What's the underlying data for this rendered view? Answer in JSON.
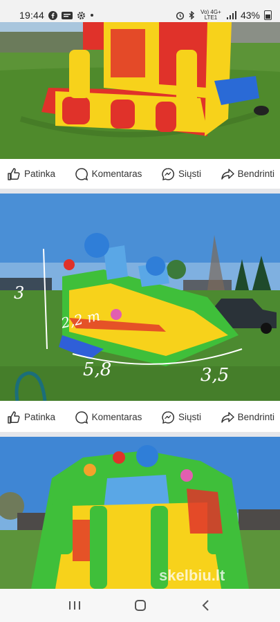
{
  "status_bar": {
    "time": "19:44",
    "network": "Vo) 4G+ LTE1",
    "battery": "43%"
  },
  "post_actions": {
    "like": "Patinka",
    "comment": "Komentaras",
    "send": "Siųsti",
    "share": "Bendrinti"
  },
  "annotations": {
    "height": "3",
    "height2": "2,2 m",
    "length": "5,8",
    "width": "3,5"
  },
  "watermark": "skelbiu.lt",
  "colors": {
    "sky": "#4a8fd6",
    "grass": "#4e8a2f",
    "slide_red": "#e0322a",
    "slide_yellow": "#f7d21b",
    "slide_green": "#3fbf3a"
  }
}
